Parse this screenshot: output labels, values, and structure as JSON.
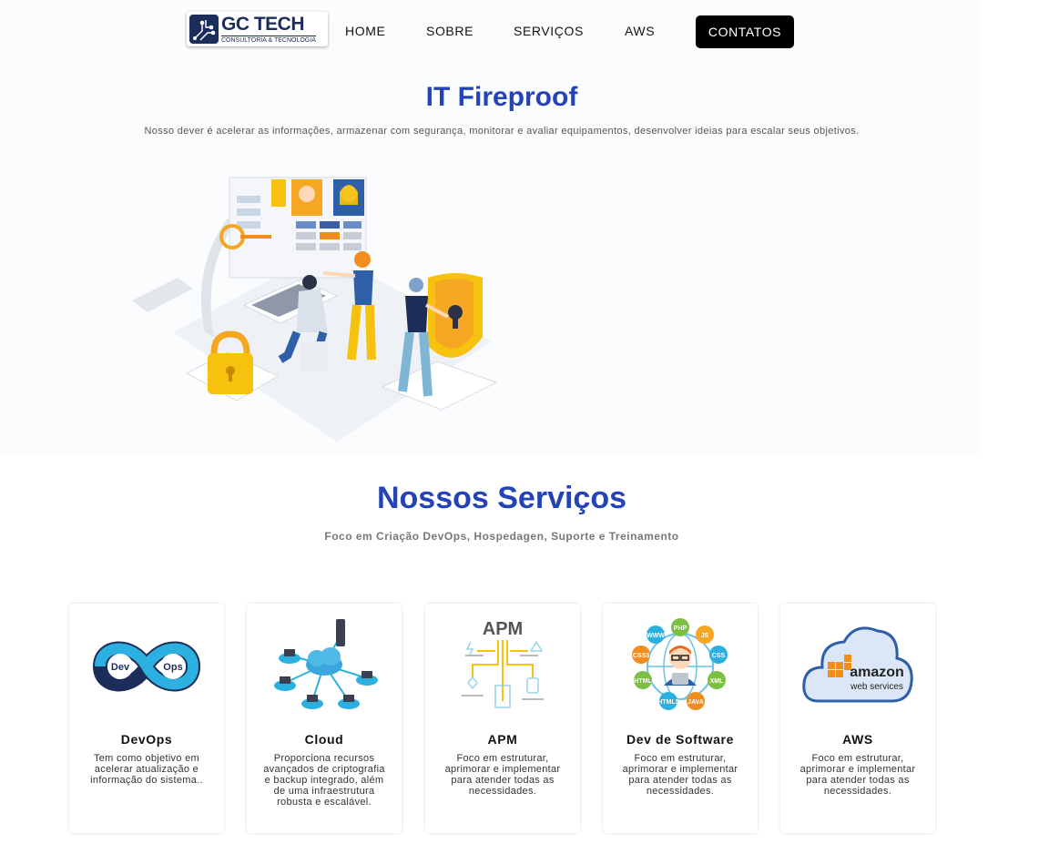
{
  "nav": {
    "logo_title": "GC TECH",
    "logo_subtitle": "CONSULTORIA & TECNOLOGIA",
    "links": [
      "HOME",
      "SOBRE",
      "SERVIÇOS",
      "AWS"
    ],
    "cta": "CONTATOS"
  },
  "hero": {
    "title": "IT Fireproof",
    "description": "Nosso dever é acelerar as informações, armazenar com segurança, monitorar e avaliar equipamentos, desenvolver ideias para escalar seus objetivos."
  },
  "services": {
    "title": "Nossos Serviços",
    "subtitle": "Foco em Criação DevOps, Hospedagen, Suporte e Treinamento",
    "cards": [
      {
        "title": "DevOps",
        "description": "Tem como objetivo em acelerar atualização e informação do sistema..",
        "icon": "devops-infinity-icon",
        "icon_labels": [
          "Dev",
          "Ops"
        ]
      },
      {
        "title": "Cloud",
        "description": "Proporciona recursos avançados de criptografia e backup integrado, além de uma infraestrutura robusta e escalável.",
        "icon": "cloud-network-icon"
      },
      {
        "title": "APM",
        "description": "Foco em estruturar, aprimorar e implementar para atender todas as necessidades.",
        "icon": "apm-diagram-icon",
        "icon_label": "APM"
      },
      {
        "title": "Dev de Software",
        "description": "Foco em estruturar, aprimorar e implementar para atender todas as necessidades.",
        "icon": "developer-languages-icon",
        "icon_labels": [
          "PHP",
          "JS",
          "CSS",
          "XML",
          "JAVA",
          "HTML5",
          "HTML",
          "CSS3",
          "WWW"
        ]
      },
      {
        "title": "AWS",
        "description": "Foco em estruturar, aprimorar e implementar para atender todas as necessidades.",
        "icon": "aws-cloud-icon",
        "icon_labels": [
          "amazon",
          "web services"
        ]
      }
    ]
  },
  "colors": {
    "accent": "#2443b6",
    "cta_bg": "#000000",
    "text": "#222222"
  }
}
